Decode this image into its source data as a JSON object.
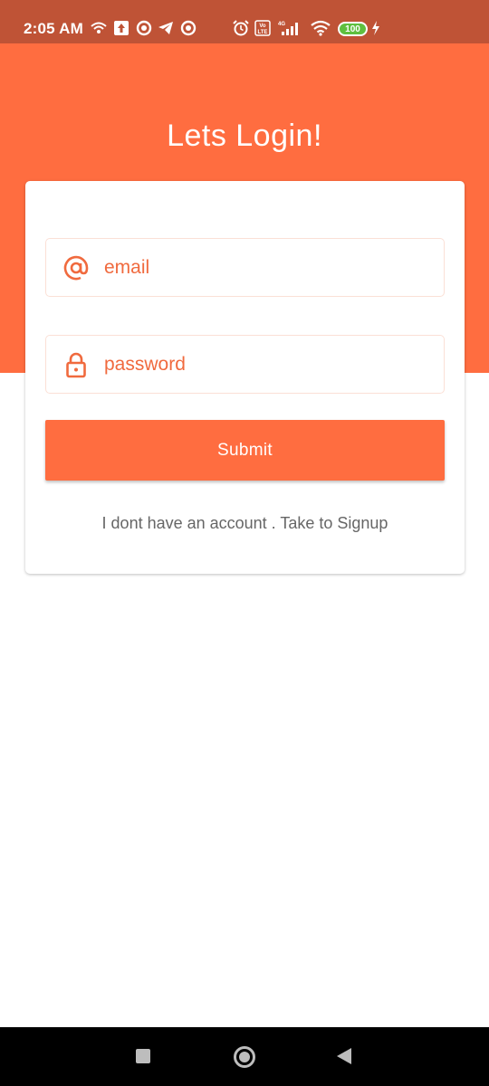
{
  "status_bar": {
    "time": "2:05 AM",
    "battery": "100",
    "network": "4G",
    "volte": "Vo LTE"
  },
  "header": {
    "title": "Lets Login!"
  },
  "form": {
    "email_placeholder": "email",
    "password_placeholder": "password",
    "submit_label": "Submit",
    "signup_text": "I dont have an account . Take to Signup"
  },
  "colors": {
    "accent": "#ff6d40",
    "status_bar": "#bf5336"
  },
  "icons": {
    "email_field": "at-sign-icon",
    "password_field": "lock-icon"
  }
}
